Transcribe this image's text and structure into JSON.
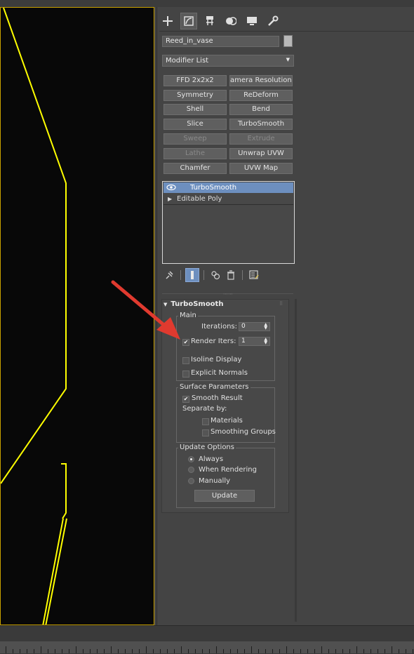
{
  "object_name": "Reed_in_vase",
  "modifier_list": {
    "label": "Modifier List"
  },
  "command_tabs": [
    {
      "icon": "create-icon"
    },
    {
      "icon": "modify-icon",
      "active": true
    },
    {
      "icon": "hierarchy-icon"
    },
    {
      "icon": "motion-icon"
    },
    {
      "icon": "display-icon"
    },
    {
      "icon": "utilities-icon"
    }
  ],
  "modifier_buttons": [
    {
      "label": "FFD 2x2x2",
      "enabled": true
    },
    {
      "label": "amera Resolution Mo",
      "enabled": true
    },
    {
      "label": "Symmetry",
      "enabled": true
    },
    {
      "label": "ReDeform",
      "enabled": true
    },
    {
      "label": "Shell",
      "enabled": true
    },
    {
      "label": "Bend",
      "enabled": true
    },
    {
      "label": "Slice",
      "enabled": true
    },
    {
      "label": "TurboSmooth",
      "enabled": true
    },
    {
      "label": "Sweep",
      "enabled": false
    },
    {
      "label": "Extrude",
      "enabled": false
    },
    {
      "label": "Lathe",
      "enabled": false
    },
    {
      "label": "Unwrap UVW",
      "enabled": true
    },
    {
      "label": "Chamfer",
      "enabled": true
    },
    {
      "label": "UVW Map",
      "enabled": true
    }
  ],
  "stack": [
    {
      "label": "TurboSmooth",
      "selected": true
    },
    {
      "label": "Editable Poly",
      "selected": false
    }
  ],
  "rollout": {
    "title": "TurboSmooth",
    "main": {
      "title": "Main",
      "iterations_label": "Iterations:",
      "iterations_value": "0",
      "render_iters_label": "Render Iters:",
      "render_iters_value": "1",
      "render_iters_checked": true,
      "isoline_label": "Isoline Display",
      "isoline_checked": false,
      "explicit_label": "Explicit Normals",
      "explicit_checked": false
    },
    "surface": {
      "title": "Surface Parameters",
      "smooth_label": "Smooth Result",
      "smooth_checked": true,
      "separate_label": "Separate by:",
      "materials_label": "Materials",
      "groups_label": "Smoothing Groups"
    },
    "update": {
      "title": "Update Options",
      "always_label": "Always",
      "rendering_label": "When Rendering",
      "manually_label": "Manually",
      "selected": "Always",
      "button_label": "Update"
    }
  },
  "colors": {
    "selection": "#6d8fbf",
    "viewport_border": "#c8a000",
    "spline": "#ffff00",
    "annotation_arrow": "#e03a2f"
  }
}
